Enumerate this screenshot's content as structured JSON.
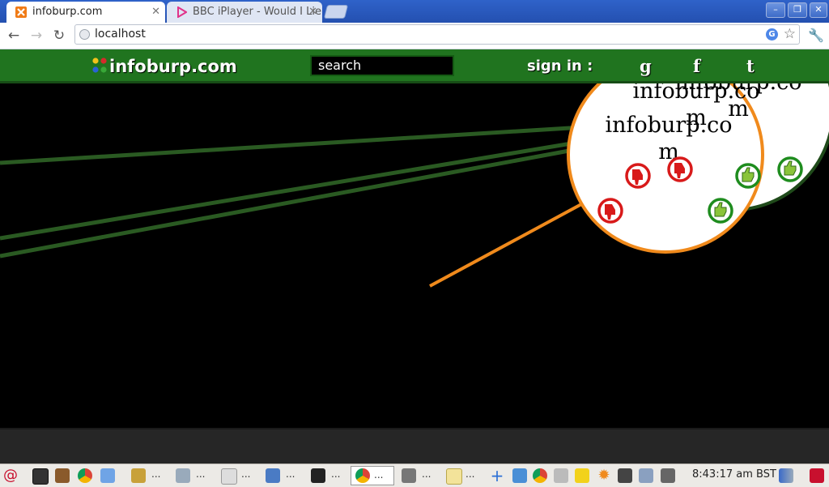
{
  "browser": {
    "tabs": [
      {
        "title": "infoburp.com",
        "active": true
      },
      {
        "title": "BBC iPlayer - Would I Lie",
        "active": false
      }
    ],
    "address": "localhost",
    "window_buttons": [
      "–",
      "❐",
      "✕"
    ]
  },
  "site": {
    "logo": "infoburp.com",
    "search_placeholder": "search",
    "signin_label": "sign in :",
    "social": [
      "g",
      "f",
      "t"
    ],
    "bubbles": [
      {
        "text_line1": "infoburp.co",
        "text_line2": "m"
      },
      {
        "text_line1": "infoburp.co",
        "text_line2": "m"
      },
      {
        "text_line1": "infoburp.co",
        "text_line2": "m"
      }
    ],
    "colors": {
      "header": "#20741f",
      "line_green": "#2a5a22",
      "line_orange": "#f08a1c",
      "thumb_up": "#1e8c1e",
      "thumb_down": "#d81a1a"
    }
  },
  "taskbar": {
    "clock": "8:43:17 am BST",
    "ellipsis": "..."
  }
}
